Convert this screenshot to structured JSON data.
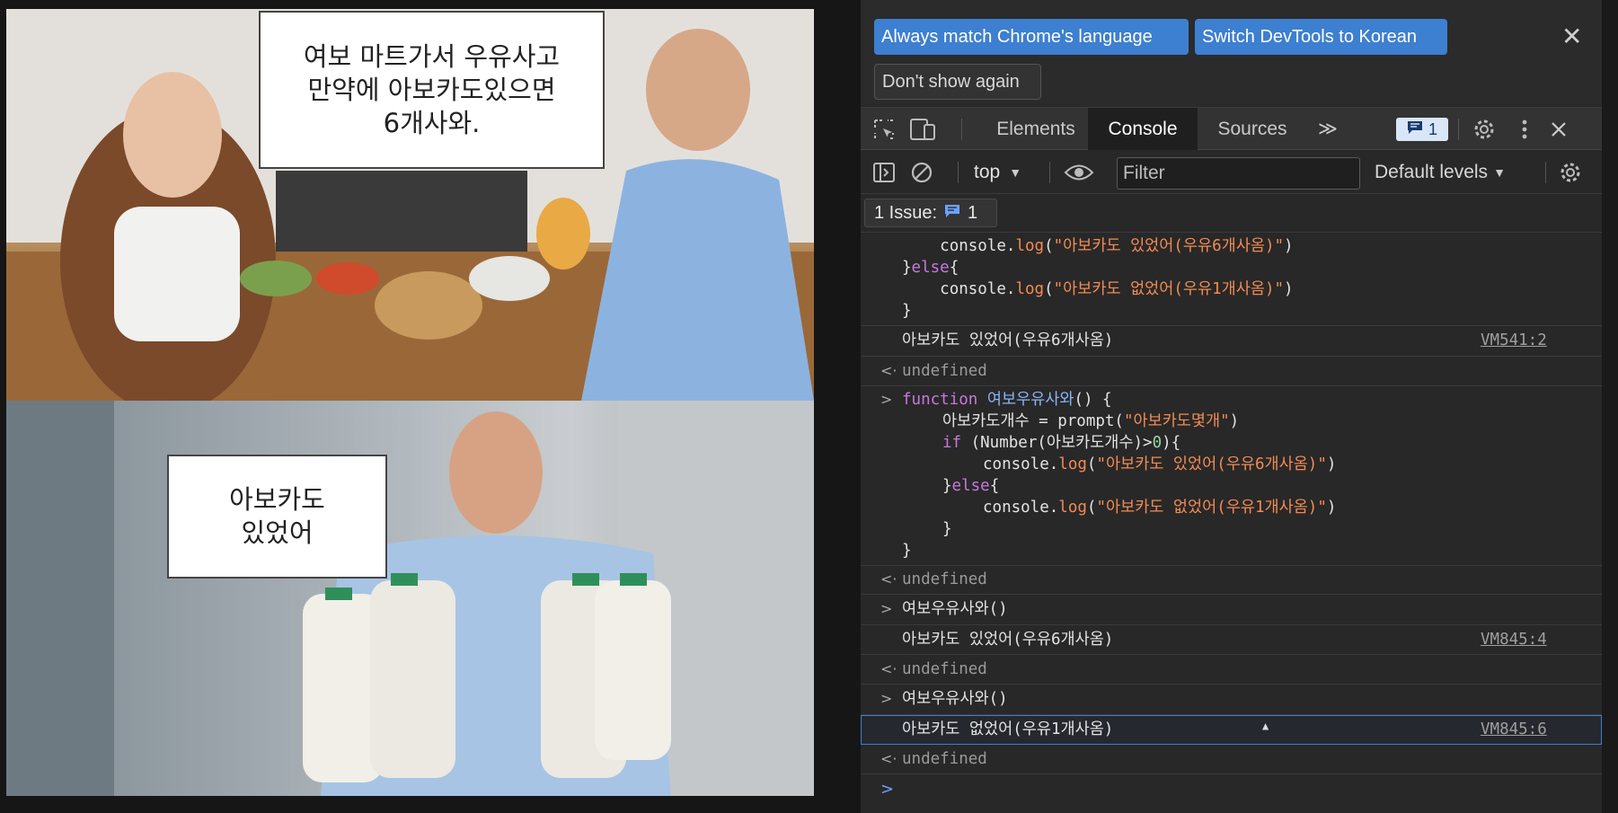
{
  "meme": {
    "bubble_top": "여보 마트가서 우유사고\n만약에 아보카도있으면\n6개사와.",
    "bubble_bottom": "아보카도\n있었어"
  },
  "language_bar": {
    "match_label": "Always match Chrome's language",
    "switch_label": "Switch DevTools to Korean",
    "dont_show_label": "Don't show again",
    "close_glyph": "✕"
  },
  "tabs": {
    "elements": "Elements",
    "console": "Console",
    "sources": "Sources",
    "more": "≫",
    "message_count": "1"
  },
  "toolbar": {
    "context": "top",
    "filter_placeholder": "Filter",
    "levels": "Default levels"
  },
  "issues": {
    "label": "1 Issue:",
    "count": "1"
  },
  "console": {
    "code1": {
      "l1_indent": "    ",
      "l1_obj": "console.",
      "l1_fn": "log",
      "l1_open": "(",
      "l1_str": "\"아보카도 있었어(우유6개사옴)\"",
      "l1_close": ")",
      "l2_brace": "}",
      "l2_kw": "else",
      "l2_open": "{",
      "l3_indent": "    ",
      "l3_obj": "console.",
      "l3_fn": "log",
      "l3_open": "(",
      "l3_str": "\"아보카도 없었어(우유1개사옴)\"",
      "l3_close": ")",
      "l4": "}"
    },
    "out1_text": "아보카도 있었어(우유6개사옴)",
    "out1_src": "VM541:2",
    "undefined": "undefined",
    "func": {
      "kw": "function",
      "name": "여보우유사와",
      "sig_rest": "() {",
      "l2_a": "아보카도개수 = prompt(",
      "l2_str": "\"아보카도몇개\"",
      "l2_b": ")",
      "l3_kw": "if",
      "l3_a": " (Number(아보카도개수)>",
      "l3_num": "0",
      "l3_b": "){",
      "l4_obj": "console.",
      "l4_fn": "log",
      "l4_open": "(",
      "l4_str": "\"아보카도 있었어(우유6개사옴)\"",
      "l4_close": ")",
      "l5_brace": "}",
      "l5_kw": "else",
      "l5_open": "{",
      "l6_obj": "console.",
      "l6_fn": "log",
      "l6_open": "(",
      "l6_str": "\"아보카도 없었어(우유1개사옴)\"",
      "l6_close": ")",
      "l7": "}",
      "l8": "}"
    },
    "call_text": "여보우유사와()",
    "out2_text": "아보카도 있었어(우유6개사옴)",
    "out2_src": "VM845:4",
    "out3_text": "아보카도 없었어(우유1개사옴)",
    "out3_src": "VM845:6",
    "input_arrow": ">",
    "result_arrow": "<·",
    "prompt_arrow": ">"
  }
}
